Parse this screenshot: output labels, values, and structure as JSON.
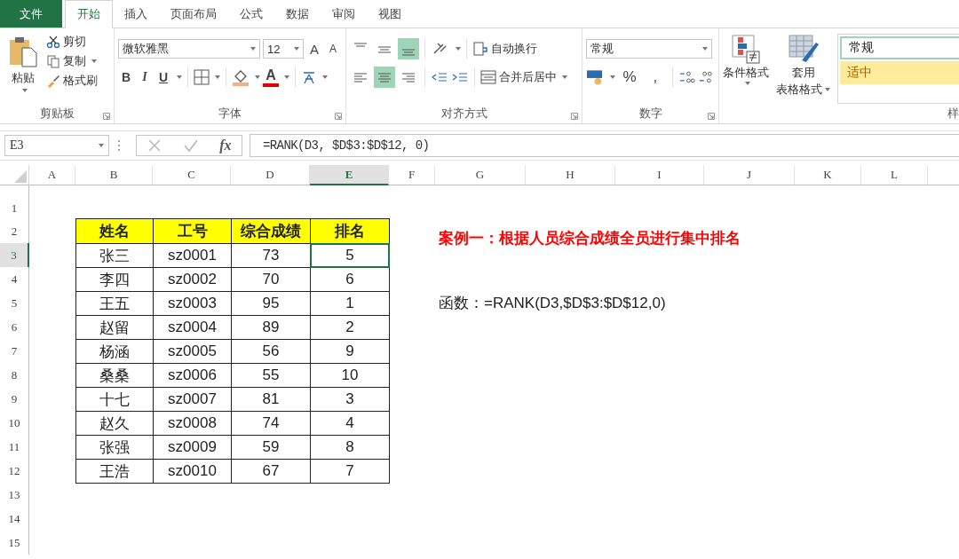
{
  "file_button": "文件",
  "tabs": [
    {
      "label": "开始",
      "selected": true
    },
    {
      "label": "插入",
      "selected": false
    },
    {
      "label": "页面布局",
      "selected": false
    },
    {
      "label": "公式",
      "selected": false
    },
    {
      "label": "数据",
      "selected": false
    },
    {
      "label": "审阅",
      "selected": false
    },
    {
      "label": "视图",
      "selected": false
    }
  ],
  "ribbon": {
    "clipboard": {
      "paste": "粘贴",
      "cut": "剪切",
      "copy": "复制",
      "format_painter": "格式刷",
      "label": "剪贴板"
    },
    "font": {
      "name": "微软雅黑",
      "size": "12",
      "grow": "A",
      "shrink": "A",
      "bold": "B",
      "italic": "I",
      "underline": "U",
      "font_color": "A",
      "label": "字体"
    },
    "alignment": {
      "vertical_align": [
        {
          "selected": false
        },
        {
          "selected": false
        },
        {
          "selected": true
        }
      ],
      "horizontal_align": [
        {
          "selected": false
        },
        {
          "selected": true
        },
        {
          "selected": false
        }
      ],
      "wrap": "自动换行",
      "merge": "合并后居中",
      "label": "对齐方式"
    },
    "number": {
      "format": "常规",
      "percent": "%",
      "comma": ",",
      "label": "数字"
    },
    "styles": {
      "conditional": "条件格式",
      "table_format": [
        "套用",
        "表格格式"
      ],
      "gallery": [
        {
          "text": "常规",
          "kind": "normal"
        },
        {
          "text": "适中",
          "kind": "neutral"
        }
      ],
      "label": "样"
    }
  },
  "formula_bar": {
    "name_box": "E3",
    "fx": "fx",
    "formula": "=RANK(D3, $D$3:$D$12, 0)"
  },
  "sheet": {
    "columns": [
      {
        "label": "A",
        "selected": false
      },
      {
        "label": "B",
        "selected": false
      },
      {
        "label": "C",
        "selected": false
      },
      {
        "label": "D",
        "selected": false
      },
      {
        "label": "E",
        "selected": true
      },
      {
        "label": "F",
        "selected": false
      },
      {
        "label": "G",
        "selected": false
      },
      {
        "label": "H",
        "selected": false
      },
      {
        "label": "I",
        "selected": false
      },
      {
        "label": "J",
        "selected": false
      },
      {
        "label": "K",
        "selected": false
      },
      {
        "label": "L",
        "selected": false
      }
    ],
    "rows": [
      {
        "label": "1",
        "selected": false
      },
      {
        "label": "2",
        "selected": false
      },
      {
        "label": "3",
        "selected": true
      },
      {
        "label": "4",
        "selected": false
      },
      {
        "label": "5",
        "selected": false
      },
      {
        "label": "6",
        "selected": false
      },
      {
        "label": "7",
        "selected": false
      },
      {
        "label": "8",
        "selected": false
      },
      {
        "label": "9",
        "selected": false
      },
      {
        "label": "10",
        "selected": false
      },
      {
        "label": "11",
        "selected": false
      },
      {
        "label": "12",
        "selected": false
      },
      {
        "label": "13",
        "selected": false
      },
      {
        "label": "14",
        "selected": false
      },
      {
        "label": "15",
        "selected": false
      }
    ],
    "table": {
      "header": [
        "姓名",
        "工号",
        "综合成绩",
        "排名"
      ],
      "rows": [
        [
          {
            "text": "张三",
            "selected": false
          },
          {
            "text": "sz0001",
            "selected": false
          },
          {
            "text": "73",
            "selected": false
          },
          {
            "text": "5",
            "selected": true
          }
        ],
        [
          {
            "text": "李四",
            "selected": false
          },
          {
            "text": "sz0002",
            "selected": false
          },
          {
            "text": "70",
            "selected": false
          },
          {
            "text": "6",
            "selected": false
          }
        ],
        [
          {
            "text": "王五",
            "selected": false
          },
          {
            "text": "sz0003",
            "selected": false
          },
          {
            "text": "95",
            "selected": false
          },
          {
            "text": "1",
            "selected": false
          }
        ],
        [
          {
            "text": "赵留",
            "selected": false
          },
          {
            "text": "sz0004",
            "selected": false
          },
          {
            "text": "89",
            "selected": false
          },
          {
            "text": "2",
            "selected": false
          }
        ],
        [
          {
            "text": "杨涵",
            "selected": false
          },
          {
            "text": "sz0005",
            "selected": false
          },
          {
            "text": "56",
            "selected": false
          },
          {
            "text": "9",
            "selected": false
          }
        ],
        [
          {
            "text": "桑桑",
            "selected": false
          },
          {
            "text": "sz0006",
            "selected": false
          },
          {
            "text": "55",
            "selected": false
          },
          {
            "text": "10",
            "selected": false
          }
        ],
        [
          {
            "text": "十七",
            "selected": false
          },
          {
            "text": "sz0007",
            "selected": false
          },
          {
            "text": "81",
            "selected": false
          },
          {
            "text": "3",
            "selected": false
          }
        ],
        [
          {
            "text": "赵久",
            "selected": false
          },
          {
            "text": "sz0008",
            "selected": false
          },
          {
            "text": "74",
            "selected": false
          },
          {
            "text": "4",
            "selected": false
          }
        ],
        [
          {
            "text": "张强",
            "selected": false
          },
          {
            "text": "sz0009",
            "selected": false
          },
          {
            "text": "59",
            "selected": false
          },
          {
            "text": "8",
            "selected": false
          }
        ],
        [
          {
            "text": "王浩",
            "selected": false
          },
          {
            "text": "sz0010",
            "selected": false
          },
          {
            "text": "67",
            "selected": false
          },
          {
            "text": "7",
            "selected": false
          }
        ]
      ]
    },
    "title": "案例一：根据人员综合成绩全员进行集中排名",
    "note": "函数：=RANK(D3,$D$3:$D$12,0)"
  }
}
